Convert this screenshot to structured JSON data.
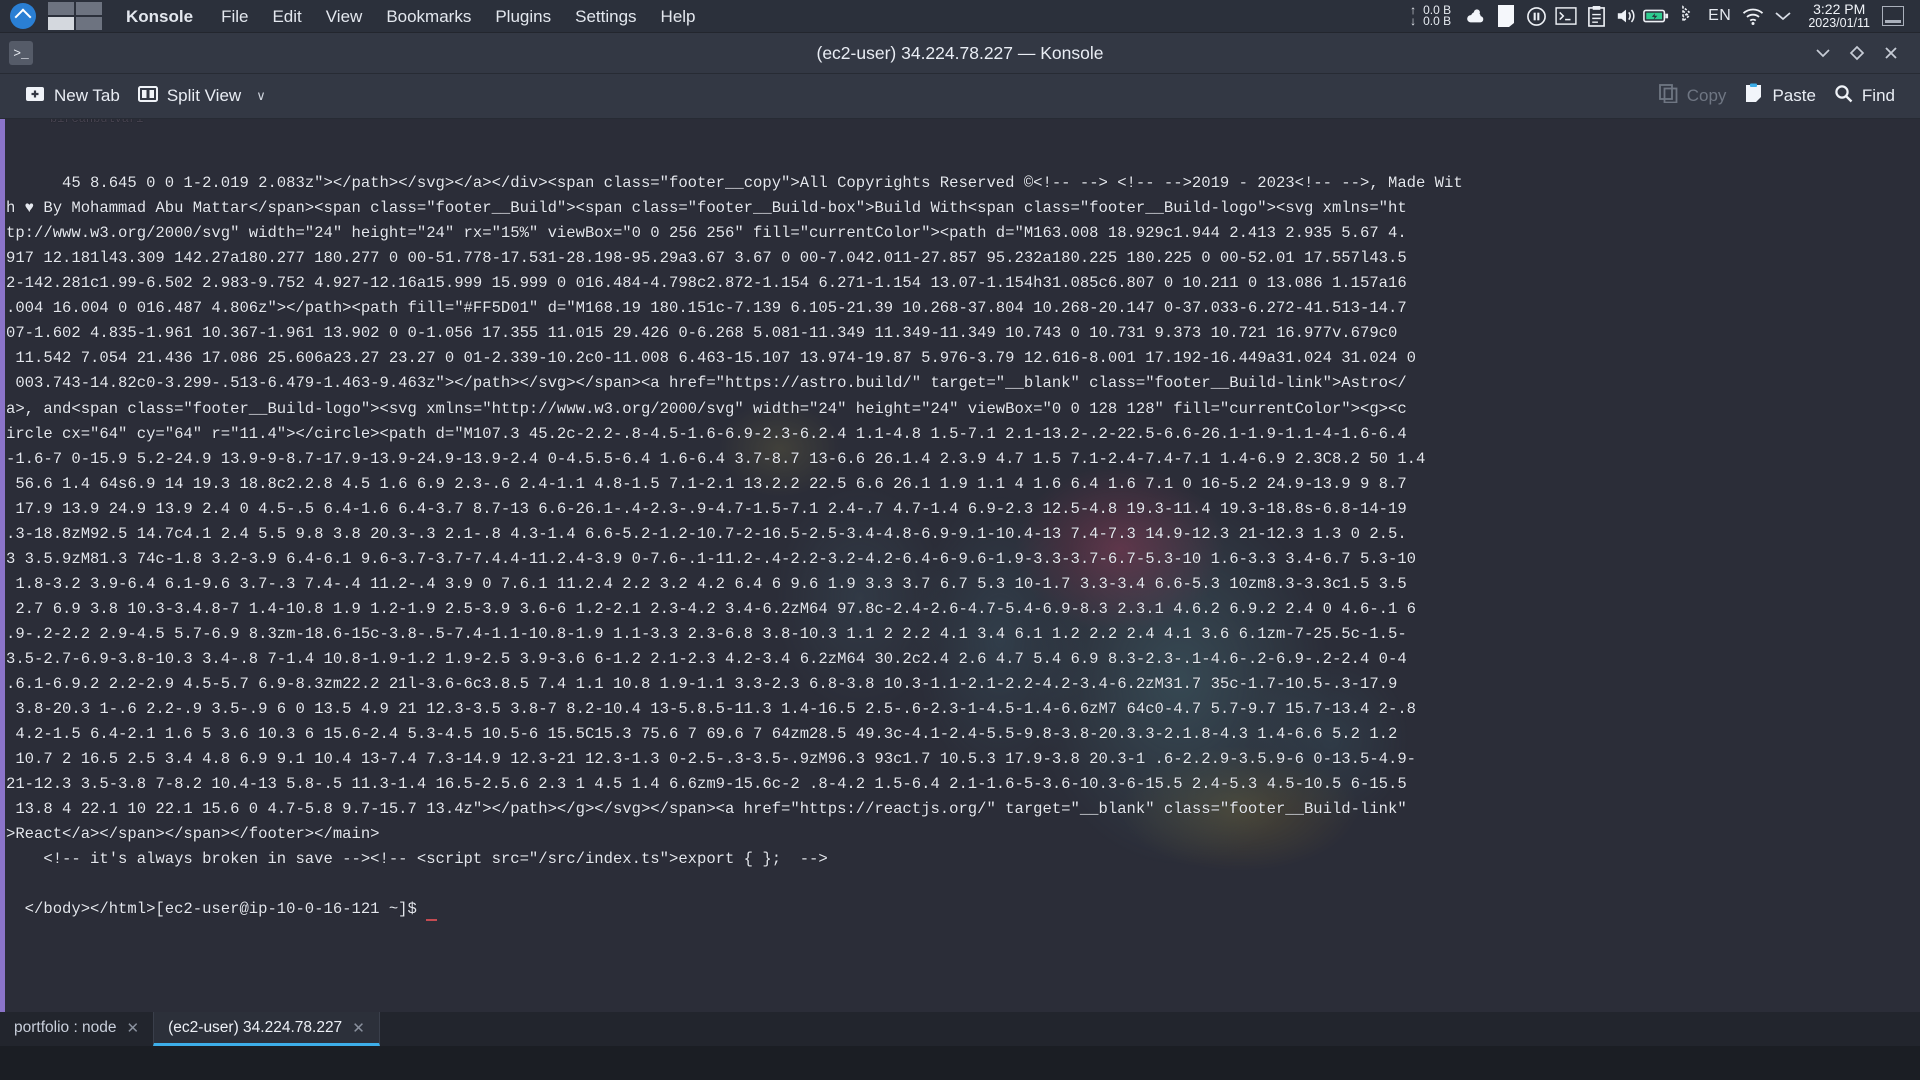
{
  "panel": {
    "logo_icon": "kde-logo-icon",
    "pager": {
      "name": "virtual-desktop-pager",
      "cells": [
        "inactive",
        "inactive",
        "active",
        "inactive"
      ]
    },
    "menu": [
      {
        "label": "Konsole",
        "name": "menu-konsole",
        "bold": true
      },
      {
        "label": "File",
        "name": "menu-file"
      },
      {
        "label": "Edit",
        "name": "menu-edit"
      },
      {
        "label": "View",
        "name": "menu-view"
      },
      {
        "label": "Bookmarks",
        "name": "menu-bookmarks"
      },
      {
        "label": "Plugins",
        "name": "menu-plugins"
      },
      {
        "label": "Settings",
        "name": "menu-settings"
      },
      {
        "label": "Help",
        "name": "menu-help"
      }
    ],
    "network": {
      "up_arrow": "↑",
      "down_arrow": "↓",
      "up_value": "0.0 B",
      "down_value": "0.0 B"
    },
    "tray_icons": [
      "weather-cloud-sun-icon",
      "note-paper-icon",
      "media-pause-icon",
      "terminal-icon",
      "clipboard-icon",
      "volume-speaker-icon",
      "battery-icon",
      "bluetooth-icon"
    ],
    "language": "EN",
    "wifi_icon": "wifi-icon",
    "tray_expand_icon": "chevron-down-icon",
    "clock": {
      "time": "3:22 PM",
      "date": "2023/01/11"
    },
    "show_desktop_icon": "show-desktop-icon"
  },
  "window": {
    "app_icon": ">_",
    "title": "(ec2-user) 34.224.78.227 — Konsole",
    "controls": [
      {
        "name": "minimize-button",
        "icon": "chevron-down-icon"
      },
      {
        "name": "maximize-button",
        "icon": "diamond-icon"
      },
      {
        "name": "close-button",
        "icon": "close-icon"
      }
    ]
  },
  "toolbar": {
    "new_tab": {
      "label": "New Tab",
      "icon": "add-tab-icon"
    },
    "split_view": {
      "label": "Split View",
      "icon": "split-view-icon",
      "caret": "∨"
    },
    "copy": {
      "label": "Copy",
      "icon": "copy-icon",
      "enabled": false
    },
    "paste": {
      "label": "Paste",
      "icon": "paste-icon",
      "enabled": true
    },
    "find": {
      "label": "Find",
      "icon": "search-icon",
      "enabled": true
    }
  },
  "terminal": {
    "scroll_marker_color": "#8b74c9",
    "ghost_text": "bircanbulvarı",
    "lines": [
      "45 8.645 0 0 1-2.019 2.083z\"></path></svg></a></div><span class=\"footer__copy\">All Copyrights Reserved ©<!-- --> <!-- -->2019 - 2023<!-- -->, Made Wit",
      "h ♥ By Mohammad Abu Mattar</span><span class=\"footer__Build\"><span class=\"footer__Build-box\">Build With<span class=\"footer__Build-logo\"><svg xmlns=\"ht",
      "tp://www.w3.org/2000/svg\" width=\"24\" height=\"24\" rx=\"15%\" viewBox=\"0 0 256 256\" fill=\"currentColor\"><path d=\"M163.008 18.929c1.944 2.413 2.935 5.67 4.",
      "917 12.181l43.309 142.27a180.277 180.277 0 00-51.778-17.531-28.198-95.29a3.67 3.67 0 00-7.042.011-27.857 95.232a180.225 180.225 0 00-52.01 17.557l43.5",
      "2-142.281c1.99-6.502 2.983-9.752 4.927-12.16a15.999 15.999 0 016.484-4.798c2.872-1.154 6.271-1.154 13.07-1.154h31.085c6.807 0 10.211 0 13.086 1.157a16",
      ".004 16.004 0 016.487 4.806z\"></path><path fill=\"#FF5D01\" d=\"M168.19 180.151c-7.139 6.105-21.39 10.268-37.804 10.268-20.147 0-37.033-6.272-41.513-14.7",
      "07-1.602 4.835-1.961 10.367-1.961 13.902 0 0-1.056 17.355 11.015 29.426 0-6.268 5.081-11.349 11.349-11.349 10.743 0 10.731 9.373 10.721 16.977v.679c0",
      " 11.542 7.054 21.436 17.086 25.606a23.27 23.27 0 01-2.339-10.2c0-11.008 6.463-15.107 13.974-19.87 5.976-3.79 12.616-8.001 17.192-16.449a31.024 31.024 0",
      " 003.743-14.82c0-3.299-.513-6.479-1.463-9.463z\"></path></svg></span><a href=\"https://astro.build/\" target=\"__blank\" class=\"footer__Build-link\">Astro</",
      "a>, and<span class=\"footer__Build-logo\"><svg xmlns=\"http://www.w3.org/2000/svg\" width=\"24\" height=\"24\" viewBox=\"0 0 128 128\" fill=\"currentColor\"><g><c",
      "ircle cx=\"64\" cy=\"64\" r=\"11.4\"></circle><path d=\"M107.3 45.2c-2.2-.8-4.5-1.6-6.9-2.3-6.2.4 1.1-4.8 1.5-7.1 2.1-13.2-.2-22.5-6.6-26.1-1.9-1.1-4-1.6-6.4",
      "-1.6-7 0-15.9 5.2-24.9 13.9-9-8.7-17.9-13.9-24.9-13.9-2.4 0-4.5.5-6.4 1.6-6.4 3.7-8.7 13-6.6 26.1.4 2.3.9 4.7 1.5 7.1-2.4-7.4-7.1 1.4-6.9 2.3C8.2 50 1.4",
      " 56.6 1.4 64s6.9 14 19.3 18.8c2.2.8 4.5 1.6 6.9 2.3-.6 2.4-1.1 4.8-1.5 7.1-2.1 13.2.2 22.5 6.6 26.1 1.9 1.1 4 1.6 6.4 1.6 7.1 0 16-5.2 24.9-13.9 9 8.7",
      " 17.9 13.9 24.9 13.9 2.4 0 4.5-.5 6.4-1.6 6.4-3.7 8.7-13 6.6-26.1-.4-2.3-.9-4.7-1.5-7.1 2.4-.7 4.7-1.4 6.9-2.3 12.5-4.8 19.3-11.4 19.3-18.8s-6.8-14-19",
      ".3-18.8zM92.5 14.7c4.1 2.4 5.5 9.8 3.8 20.3-.3 2.1-.8 4.3-1.4 6.6-5.2-1.2-10.7-2-16.5-2.5-3.4-4.8-6.9-9.1-10.4-13 7.4-7.3 14.9-12.3 21-12.3 1.3 0 2.5.",
      "3 3.5.9zM81.3 74c-1.8 3.2-3.9 6.4-6.1 9.6-3.7-3.7-7.4.4-11.2.4-3.9 0-7.6-.1-11.2-.4-2.2-3.2-4.2-6.4-6-9.6-1.9-3.3-3.7-6.7-5.3-10 1.6-3.3 3.4-6.7 5.3-10",
      " 1.8-3.2 3.9-6.4 6.1-9.6 3.7-.3 7.4-.4 11.2-.4 3.9 0 7.6.1 11.2.4 2.2 3.2 4.2 6.4 6 9.6 1.9 3.3 3.7 6.7 5.3 10-1.7 3.3-3.4 6.6-5.3 10zm8.3-3.3c1.5 3.5",
      " 2.7 6.9 3.8 10.3-3.4.8-7 1.4-10.8 1.9 1.2-1.9 2.5-3.9 3.6-6 1.2-2.1 2.3-4.2 3.4-6.2zM64 97.8c-2.4-2.6-4.7-5.4-6.9-8.3 2.3.1 4.6.2 6.9.2 2.4 0 4.6-.1 6",
      ".9-.2-2.2 2.9-4.5 5.7-6.9 8.3zm-18.6-15c-3.8-.5-7.4-1.1-10.8-1.9 1.1-3.3 2.3-6.8 3.8-10.3 1.1 2 2.2 4.1 3.4 6.1 1.2 2.2 2.4 4.1 3.6 6.1zm-7-25.5c-1.5-",
      "3.5-2.7-6.9-3.8-10.3 3.4-.8 7-1.4 10.8-1.9-1.2 1.9-2.5 3.9-3.6 6-1.2 2.1-2.3 4.2-3.4 6.2zM64 30.2c2.4 2.6 4.7 5.4 6.9 8.3-2.3-.1-4.6-.2-6.9-.2-2.4 0-4",
      ".6.1-6.9.2 2.2-2.9 4.5-5.7 6.9-8.3zm22.2 21l-3.6-6c3.8.5 7.4 1.1 10.8 1.9-1.1 3.3-2.3 6.8-3.8 10.3-1.1-2.1-2.2-4.2-3.4-6.2zM31.7 35c-1.7-10.5-.3-17.9",
      " 3.8-20.3 1-.6 2.2-.9 3.5-.9 6 0 13.5 4.9 21 12.3-3.5 3.8-7 8.2-10.4 13-5.8.5-11.3 1.4-16.5 2.5-.6-2.3-1-4.5-1.4-6.6zM7 64c0-4.7 5.7-9.7 15.7-13.4 2-.8",
      " 4.2-1.5 6.4-2.1 1.6 5 3.6 10.3 6 15.6-2.4 5.3-4.5 10.5-6 15.5C15.3 75.6 7 69.6 7 64zm28.5 49.3c-4.1-2.4-5.5-9.8-3.8-20.3.3-2.1.8-4.3 1.4-6.6 5.2 1.2",
      " 10.7 2 16.5 2.5 3.4 4.8 6.9 9.1 10.4 13-7.4 7.3-14.9 12.3-21 12.3-1.3 0-2.5-.3-3.5-.9zM96.3 93c1.7 10.5.3 17.9-3.8 20.3-1 .6-2.2.9-3.5.9-6 0-13.5-4.9-",
      "21-12.3 3.5-3.8 7-8.2 10.4-13 5.8-.5 11.3-1.4 16.5-2.5.6 2.3 1 4.5 1.4 6.6zm9-15.6c-2 .8-4.2 1.5-6.4 2.1-1.6-5-3.6-10.3-6-15.5 2.4-5.3 4.5-10.5 6-15.5",
      " 13.8 4 22.1 10 22.1 15.6 0 4.7-5.8 9.7-15.7 13.4z\"></path></g></svg></span><a href=\"https://reactjs.org/\" target=\"__blank\" class=\"footer__Build-link\"",
      ">React</a></span></span></footer></main>",
      "    <!-- it's always broken in save --><!-- <script src=\"/src/index.ts\">export { };  -->",
      "",
      "  </body></html>[ec2-user@ip-10-0-16-121 ~]$ "
    ]
  },
  "taskbar": {
    "tasks": [
      {
        "label": "portfolio : node",
        "name": "taskbar-item-portfolio-node",
        "active": false,
        "close_icon": "close-icon"
      },
      {
        "label": "(ec2-user) 34.224.78.227",
        "name": "taskbar-item-ec2-user",
        "active": true,
        "close_icon": "close-icon"
      }
    ],
    "active_accent": "#3daee9"
  }
}
